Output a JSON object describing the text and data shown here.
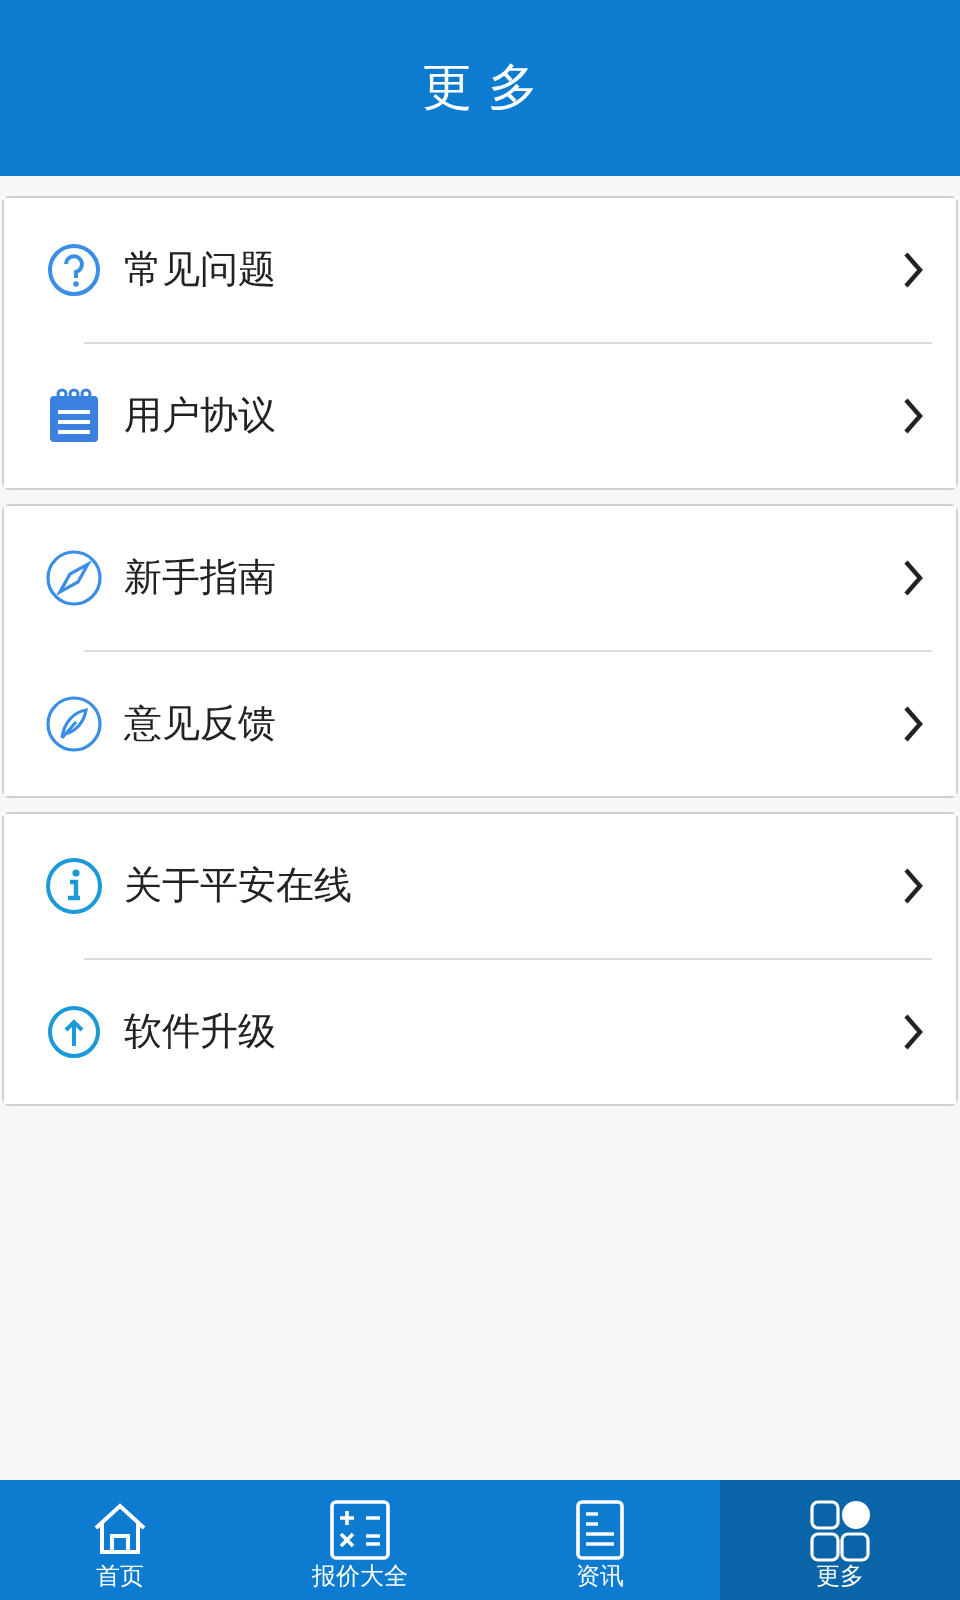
{
  "header": {
    "title": "更 多"
  },
  "groups": [
    {
      "items": [
        {
          "label": "常见问题"
        },
        {
          "label": "用户协议"
        }
      ]
    },
    {
      "items": [
        {
          "label": "新手指南"
        },
        {
          "label": "意见反馈"
        }
      ]
    },
    {
      "items": [
        {
          "label": "关于平安在线"
        },
        {
          "label": "软件升级"
        }
      ]
    }
  ],
  "tabbar": [
    {
      "label": "首页",
      "selected": false
    },
    {
      "label": "报价大全",
      "selected": false
    },
    {
      "label": "资讯",
      "selected": false
    },
    {
      "label": "更多",
      "selected": true
    }
  ]
}
